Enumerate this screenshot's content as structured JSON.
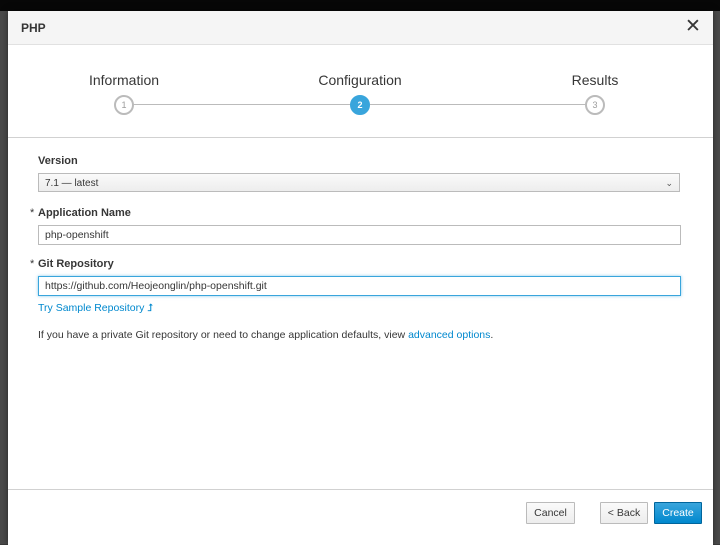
{
  "modal": {
    "title": "PHP",
    "close_symbol": "✕"
  },
  "wizard": {
    "steps": [
      {
        "label": "Information",
        "number": "1",
        "active": false
      },
      {
        "label": "Configuration",
        "number": "2",
        "active": true
      },
      {
        "label": "Results",
        "number": "3",
        "active": false
      }
    ]
  },
  "form": {
    "version": {
      "label": "Version",
      "value": "7.1 — latest"
    },
    "app_name": {
      "label": "Application Name",
      "required_mark": "*",
      "value": "php-openshift"
    },
    "git_repo": {
      "label": "Git Repository",
      "required_mark": "*",
      "value": "https://github.com/Heojeonglin/php-openshift.git"
    },
    "sample_link": "Try Sample Repository ⮥",
    "help_prefix": "If you have a private Git repository or need to change application defaults, view ",
    "help_link": "advanced options",
    "help_suffix": "."
  },
  "footer": {
    "cancel": "Cancel",
    "back": "< Back",
    "create": "Create"
  },
  "colors": {
    "accent": "#39a5dc",
    "link": "#0088ce",
    "primary_button": "#0088ce"
  }
}
